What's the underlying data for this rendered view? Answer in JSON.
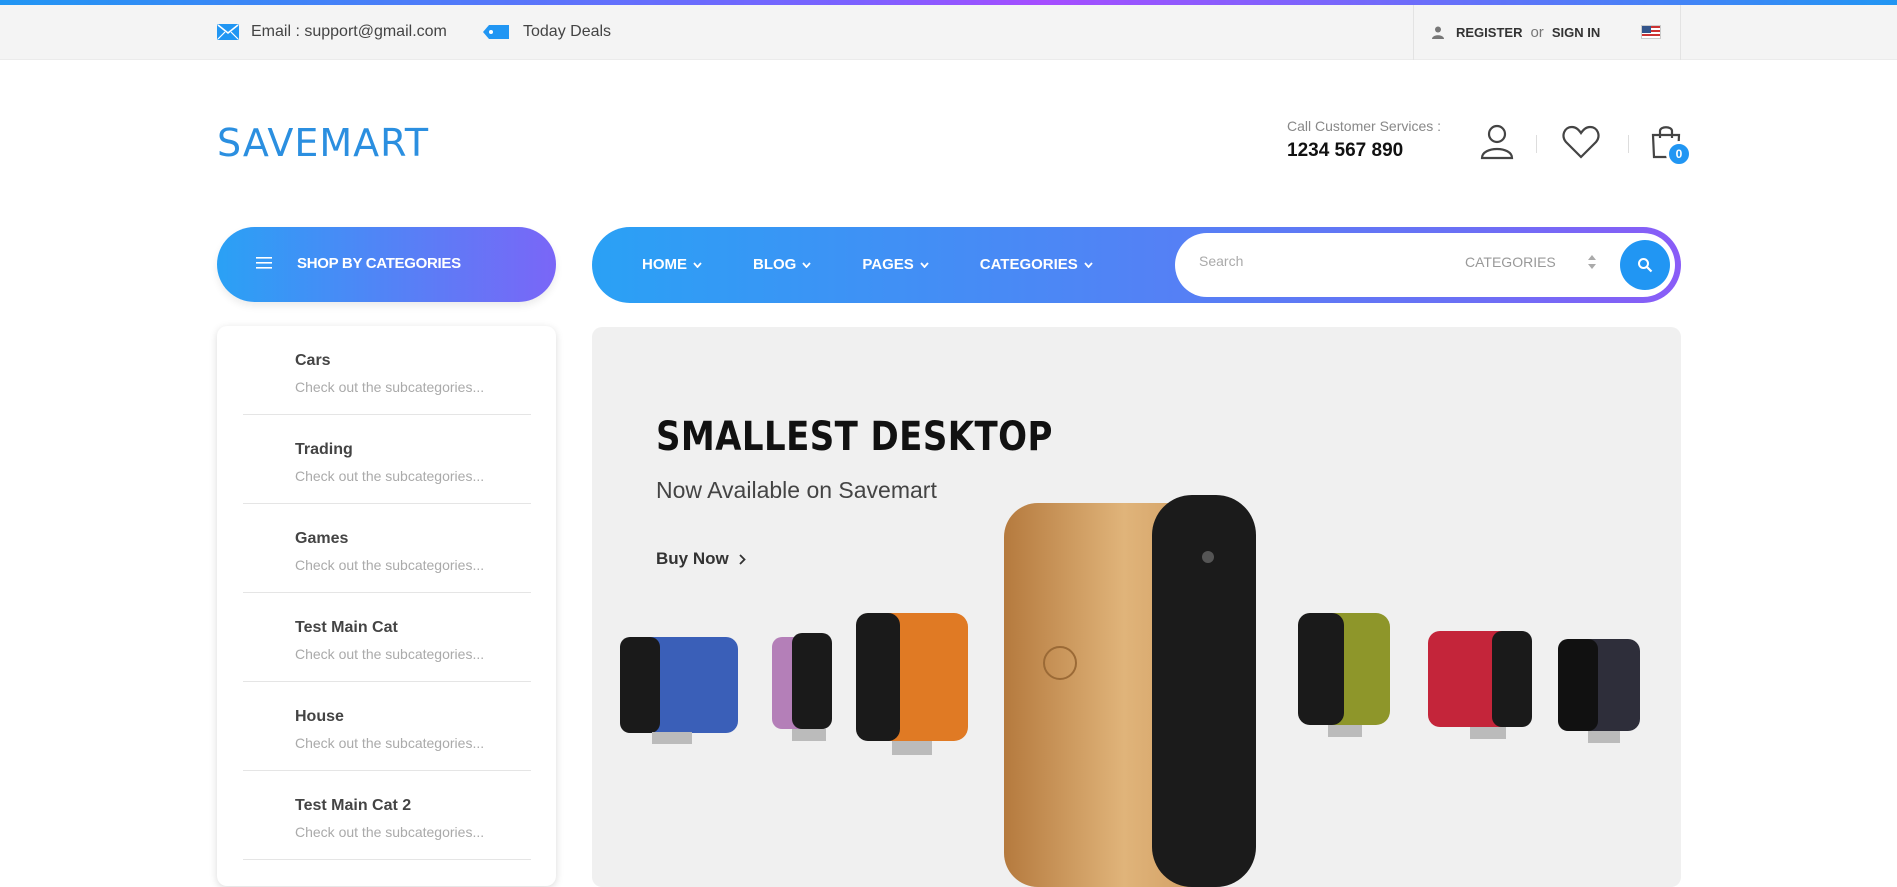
{
  "topbar": {
    "email_label": "Email : support@gmail.com",
    "deals_label": "Today Deals",
    "register_label": "REGISTER",
    "or_label": "or",
    "signin_label": "SIGN IN"
  },
  "header": {
    "logo": "SAVEMART",
    "call_label": "Call Customer Services :",
    "call_number": "1234 567 890",
    "cart_count": "0"
  },
  "nav": {
    "categories_button": "SHOP BY CATEGORIES",
    "menu": [
      "HOME",
      "BLOG",
      "PAGES",
      "CATEGORIES"
    ],
    "search_placeholder": "Search",
    "search_category": "CATEGORIES"
  },
  "categories": [
    {
      "title": "Cars",
      "subtitle": "Check out the subcategories..."
    },
    {
      "title": "Trading",
      "subtitle": "Check out the subcategories..."
    },
    {
      "title": "Games",
      "subtitle": "Check out the subcategories..."
    },
    {
      "title": "Test Main Cat",
      "subtitle": "Check out the subcategories..."
    },
    {
      "title": "House",
      "subtitle": "Check out the subcategories..."
    },
    {
      "title": "Test Main Cat 2",
      "subtitle": "Check out the subcategories..."
    }
  ],
  "banner": {
    "title": "SMALLEST DESKTOP",
    "subtitle": "Now Available on Savemart",
    "cta": "Buy Now"
  },
  "colors": {
    "accent": "#2196f3",
    "gradient_end": "#7a66f7"
  }
}
